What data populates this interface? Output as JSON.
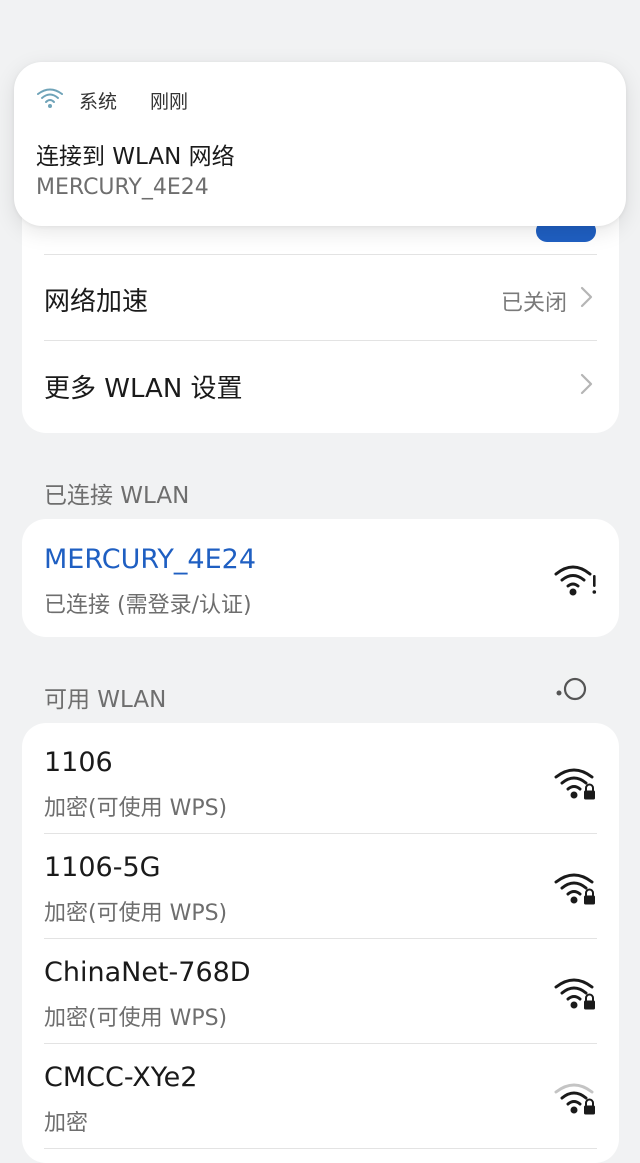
{
  "notification": {
    "app_name": "系统",
    "time": "刚刚",
    "title": "连接到 WLAN 网络",
    "body": "MERCURY_4E24",
    "icon": "wifi-question-icon"
  },
  "settings": {
    "accel_label": "网络加速",
    "accel_value": "已关闭",
    "more_label": "更多 WLAN 设置"
  },
  "connected": {
    "section_title": "已连接 WLAN",
    "name": "MERCURY_4E24",
    "status": "已连接 (需登录/认证)",
    "accent": "#1f5fc2"
  },
  "available": {
    "section_title": "可用 WLAN",
    "networks": [
      {
        "name": "1106",
        "security": "加密(可使用 WPS)"
      },
      {
        "name": "1106-5G",
        "security": "加密(可使用 WPS)"
      },
      {
        "name": "ChinaNet-768D",
        "security": "加密(可使用 WPS)"
      },
      {
        "name": "CMCC-XYe2",
        "security": "加密"
      }
    ]
  }
}
